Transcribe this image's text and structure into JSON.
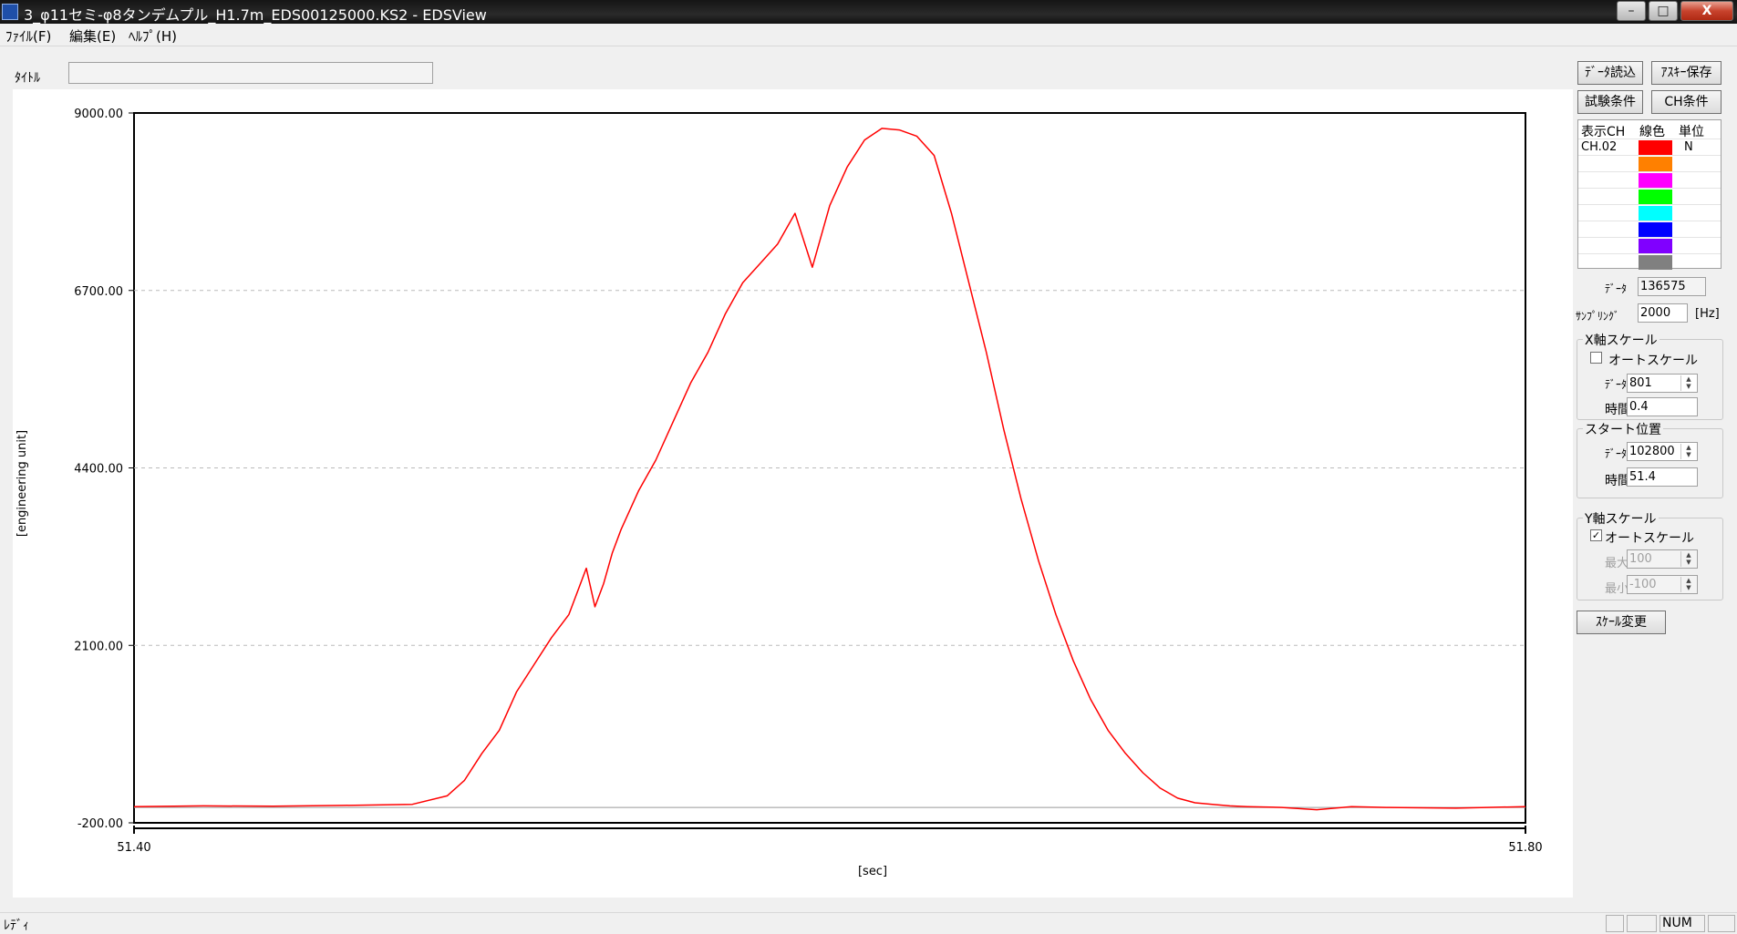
{
  "window": {
    "title": "3_φ11セミ-φ8タンデムプル_H1.7m_EDS00125000.KS2 - EDSView",
    "buttons": {
      "minimize": "–",
      "maximize": "□",
      "close": "X"
    }
  },
  "menu": [
    "ﾌｧｲﾙ(F)",
    "編集(E)",
    "ﾍﾙﾌﾟ(H)"
  ],
  "title_row": {
    "label": "ﾀｲﾄﾙ",
    "value": ""
  },
  "toolbar": {
    "load_data": "ﾃﾞｰﾀ読込",
    "ascii_save": "ｱｽｷｰ保存",
    "test_conditions": "試験条件",
    "ch_conditions": "CH条件"
  },
  "channel_table": {
    "headers": [
      "表示CH",
      "線色",
      "単位"
    ],
    "rows": [
      {
        "name": "CH.02",
        "color": "#ff0000",
        "unit": "N"
      },
      {
        "name": "",
        "color": "#ff8000",
        "unit": ""
      },
      {
        "name": "",
        "color": "#ff00ff",
        "unit": ""
      },
      {
        "name": "",
        "color": "#00ff00",
        "unit": ""
      },
      {
        "name": "",
        "color": "#00ffff",
        "unit": ""
      },
      {
        "name": "",
        "color": "#0000ff",
        "unit": ""
      },
      {
        "name": "",
        "color": "#8000ff",
        "unit": ""
      },
      {
        "name": "",
        "color": "#808080",
        "unit": ""
      }
    ]
  },
  "info": {
    "data_label": "ﾃﾞｰﾀ",
    "data_value": "136575",
    "sampling_label": "ｻﾝﾌﾟﾘﾝｸﾞ",
    "sampling_value": "2000",
    "sampling_unit": "[Hz]"
  },
  "x_scale": {
    "title": "X軸スケール",
    "auto_label": "オートスケール",
    "auto_checked": false,
    "data_label": "ﾃﾞｰﾀ",
    "data_value": "801",
    "time_label": "時間",
    "time_value": "0.4"
  },
  "start": {
    "title": "スタート位置",
    "data_label": "ﾃﾞｰﾀ",
    "data_value": "102800",
    "time_label": "時間",
    "time_value": "51.4"
  },
  "y_scale": {
    "title": "Y軸スケール",
    "auto_label": "オートスケール",
    "auto_checked": true,
    "max_label": "最大",
    "max_value": "100",
    "min_label": "最小",
    "min_value": "-100"
  },
  "scale_change": "ｽｹｰﾙ変更",
  "status": {
    "text": "ﾚﾃﾞｨ",
    "panes": [
      "",
      "",
      "NUM",
      ""
    ]
  },
  "chart_data": {
    "type": "line",
    "xlabel": "[sec]",
    "ylabel": "[engineering unit]",
    "xlim": [
      51.4,
      51.8
    ],
    "ylim": [
      -200,
      9000
    ],
    "x_ticks": [
      "51.40",
      "51.80"
    ],
    "y_ticks": [
      "9000.00",
      "6700.00",
      "4400.00",
      "2100.00",
      "-200.00"
    ],
    "grid": "horizontal dashed",
    "series": [
      {
        "color": "#ff0000",
        "x": [
          51.4,
          51.42,
          51.44,
          51.46,
          51.48,
          51.49,
          51.495,
          51.5,
          51.505,
          51.51,
          51.515,
          51.52,
          51.525,
          51.53,
          51.5325,
          51.535,
          51.5375,
          51.54,
          51.545,
          51.55,
          51.555,
          51.56,
          51.565,
          51.57,
          51.575,
          51.58,
          51.585,
          51.59,
          51.595,
          51.6,
          51.605,
          51.61,
          51.615,
          51.62,
          51.625,
          51.63,
          51.635,
          51.64,
          51.645,
          51.65,
          51.655,
          51.66,
          51.665,
          51.67,
          51.675,
          51.68,
          51.685,
          51.69,
          51.695,
          51.7,
          51.705,
          51.71,
          51.715,
          51.72,
          51.73,
          51.74,
          51.75,
          51.76,
          51.78,
          51.8
        ],
        "y": [
          10,
          20,
          15,
          25,
          40,
          150,
          350,
          700,
          1000,
          1500,
          1850,
          2200,
          2500,
          3100,
          2600,
          2900,
          3300,
          3600,
          4100,
          4500,
          5000,
          5500,
          5900,
          6400,
          6800,
          7050,
          7300,
          7700,
          7000,
          7800,
          8300,
          8650,
          8800,
          8780,
          8700,
          8450,
          7700,
          6800,
          5900,
          4900,
          4000,
          3200,
          2500,
          1900,
          1400,
          1000,
          700,
          450,
          250,
          120,
          60,
          40,
          20,
          10,
          0,
          -30,
          10,
          0,
          -10,
          10
        ]
      }
    ]
  }
}
